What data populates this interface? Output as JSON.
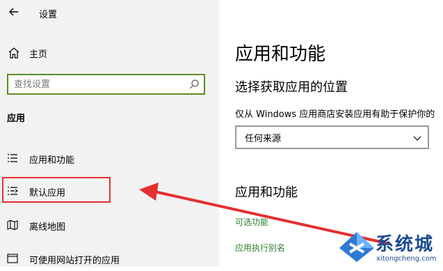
{
  "sidebar": {
    "title": "设置",
    "home_label": "主页",
    "search_placeholder": "查找设置",
    "section_heading": "应用",
    "items": [
      {
        "label": "应用和功能"
      },
      {
        "label": "默认应用"
      },
      {
        "label": "离线地图"
      },
      {
        "label": "可使用网站打开的应用"
      }
    ]
  },
  "main": {
    "title": "应用和功能",
    "install_heading": "选择获取应用的位置",
    "install_desc": "仅从 Windows 应用商店安装应用有助于保护你的",
    "dropdown_value": "任何来源",
    "apps_heading": "应用和功能",
    "link_optional": "可选功能",
    "link_alias": "应用执行别名"
  },
  "watermark": {
    "brand": "系统城",
    "url": "xitongcheng.com"
  },
  "colors": {
    "accent_green": "#5a8f1f",
    "link_green": "#2d7d2d",
    "highlight_red": "#e33030",
    "sidebar_bg": "#f2f2f2"
  }
}
